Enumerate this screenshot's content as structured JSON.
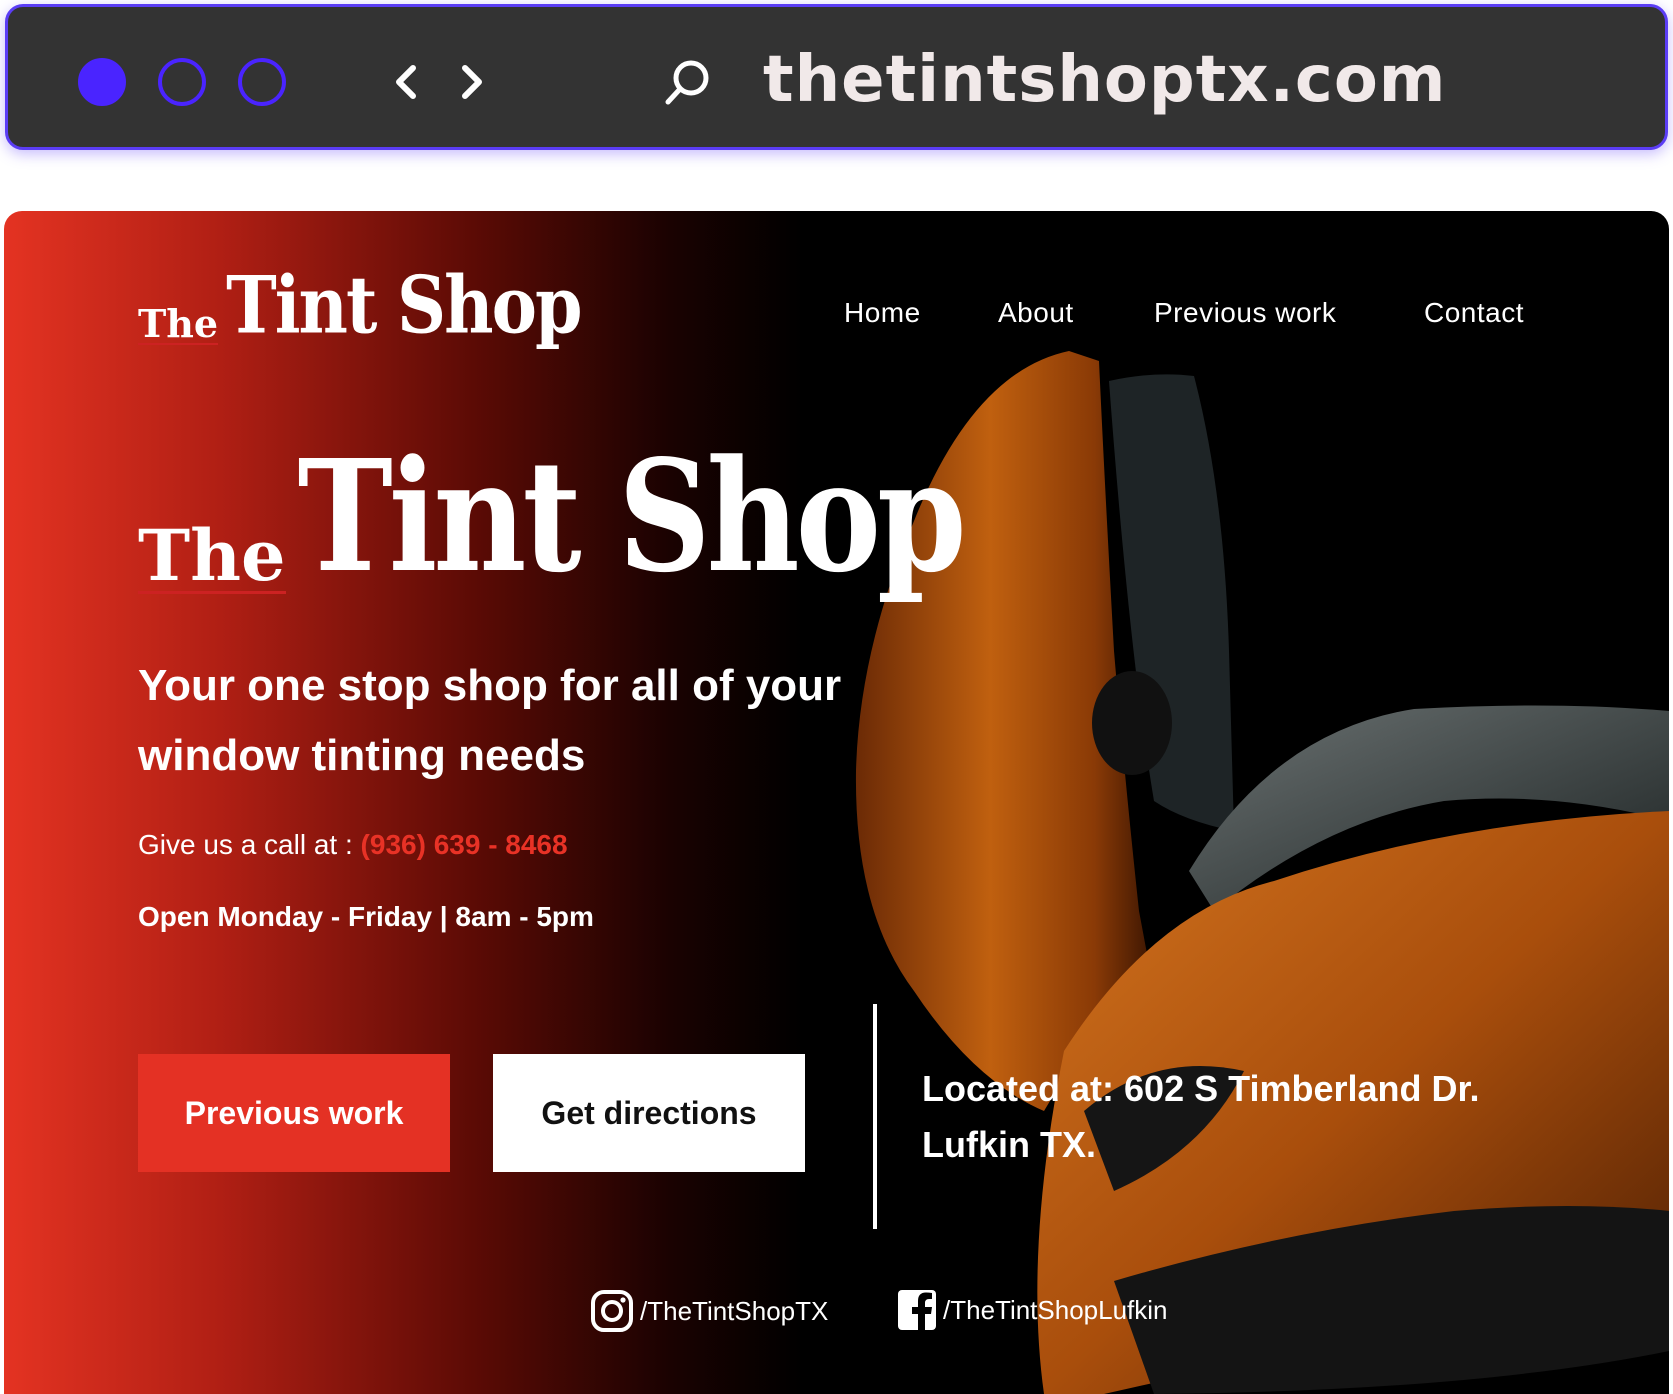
{
  "browser": {
    "url": "thetintshoptx.com",
    "accent_color": "#4a24ff",
    "icons": [
      "window-close-dot",
      "window-minimize-dot",
      "window-maximize-dot",
      "back-arrow-icon",
      "forward-arrow-icon",
      "search-icon"
    ]
  },
  "site": {
    "logo": {
      "the": "The",
      "main": "Tint Shop"
    },
    "nav": [
      "Home",
      "About",
      "Previous work",
      "Contact"
    ],
    "hero_logo": {
      "the": "The",
      "main": "Tint Shop"
    },
    "tagline": "Your one stop shop for all of your window tinting needs",
    "call_prefix": "Give us a call at :",
    "phone": "(936) 639 - 8468",
    "hours": "Open Monday - Friday | 8am - 5pm",
    "buttons": {
      "primary": "Previous work",
      "secondary": "Get directions"
    },
    "address_line1": "Located at: 602 S Timberland Dr.",
    "address_line2": "Lufkin TX.",
    "social": {
      "instagram": "/TheTintShopTX",
      "facebook": "/TheTintShopLufkin"
    },
    "colors": {
      "brand_red": "#e43124",
      "phone_red": "#e83226",
      "background": "#000000"
    }
  }
}
